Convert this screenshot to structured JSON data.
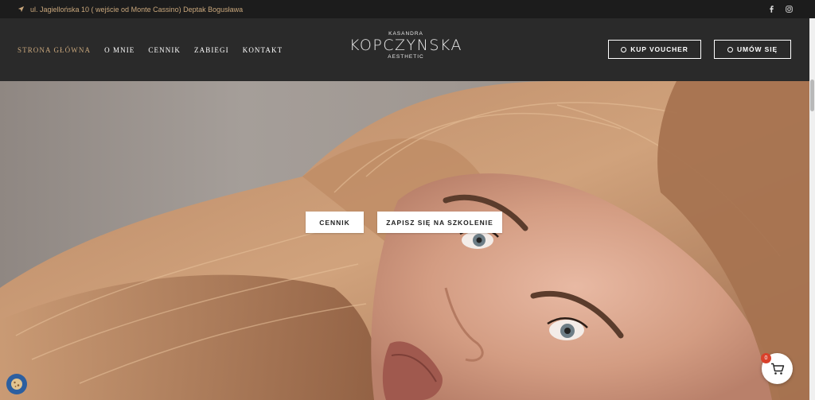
{
  "topbar": {
    "address": "ul. Jagiellońska 10 ( wejście od Monte Cassino) Deptak Bogusława",
    "location_icon": "location-arrow-icon",
    "social": [
      "facebook-icon",
      "instagram-icon"
    ]
  },
  "nav": {
    "items": [
      {
        "label": "STRONA GŁÓWNA",
        "active": true
      },
      {
        "label": "O MNIE",
        "active": false
      },
      {
        "label": "CENNIK",
        "active": false
      },
      {
        "label": "ZABIEGI",
        "active": false
      },
      {
        "label": "KONTAKT",
        "active": false
      }
    ]
  },
  "logo": {
    "top": "KASANDRA",
    "main": "KOPCZYNSKA",
    "bottom": "AESTHETIC"
  },
  "header_buttons": {
    "voucher": "KUP VOUCHER",
    "umow": "UMÓW SIĘ"
  },
  "hero": {
    "cennik_button": "CENNIK",
    "zapisz_button": "ZAPISZ SIĘ NA SZKOLENIE"
  },
  "cart": {
    "count": "0"
  },
  "colors": {
    "accent": "#c9a77c",
    "header_bg": "#2a2a2a",
    "topbar_bg": "#1c1c1c",
    "badge": "#d9402a"
  }
}
